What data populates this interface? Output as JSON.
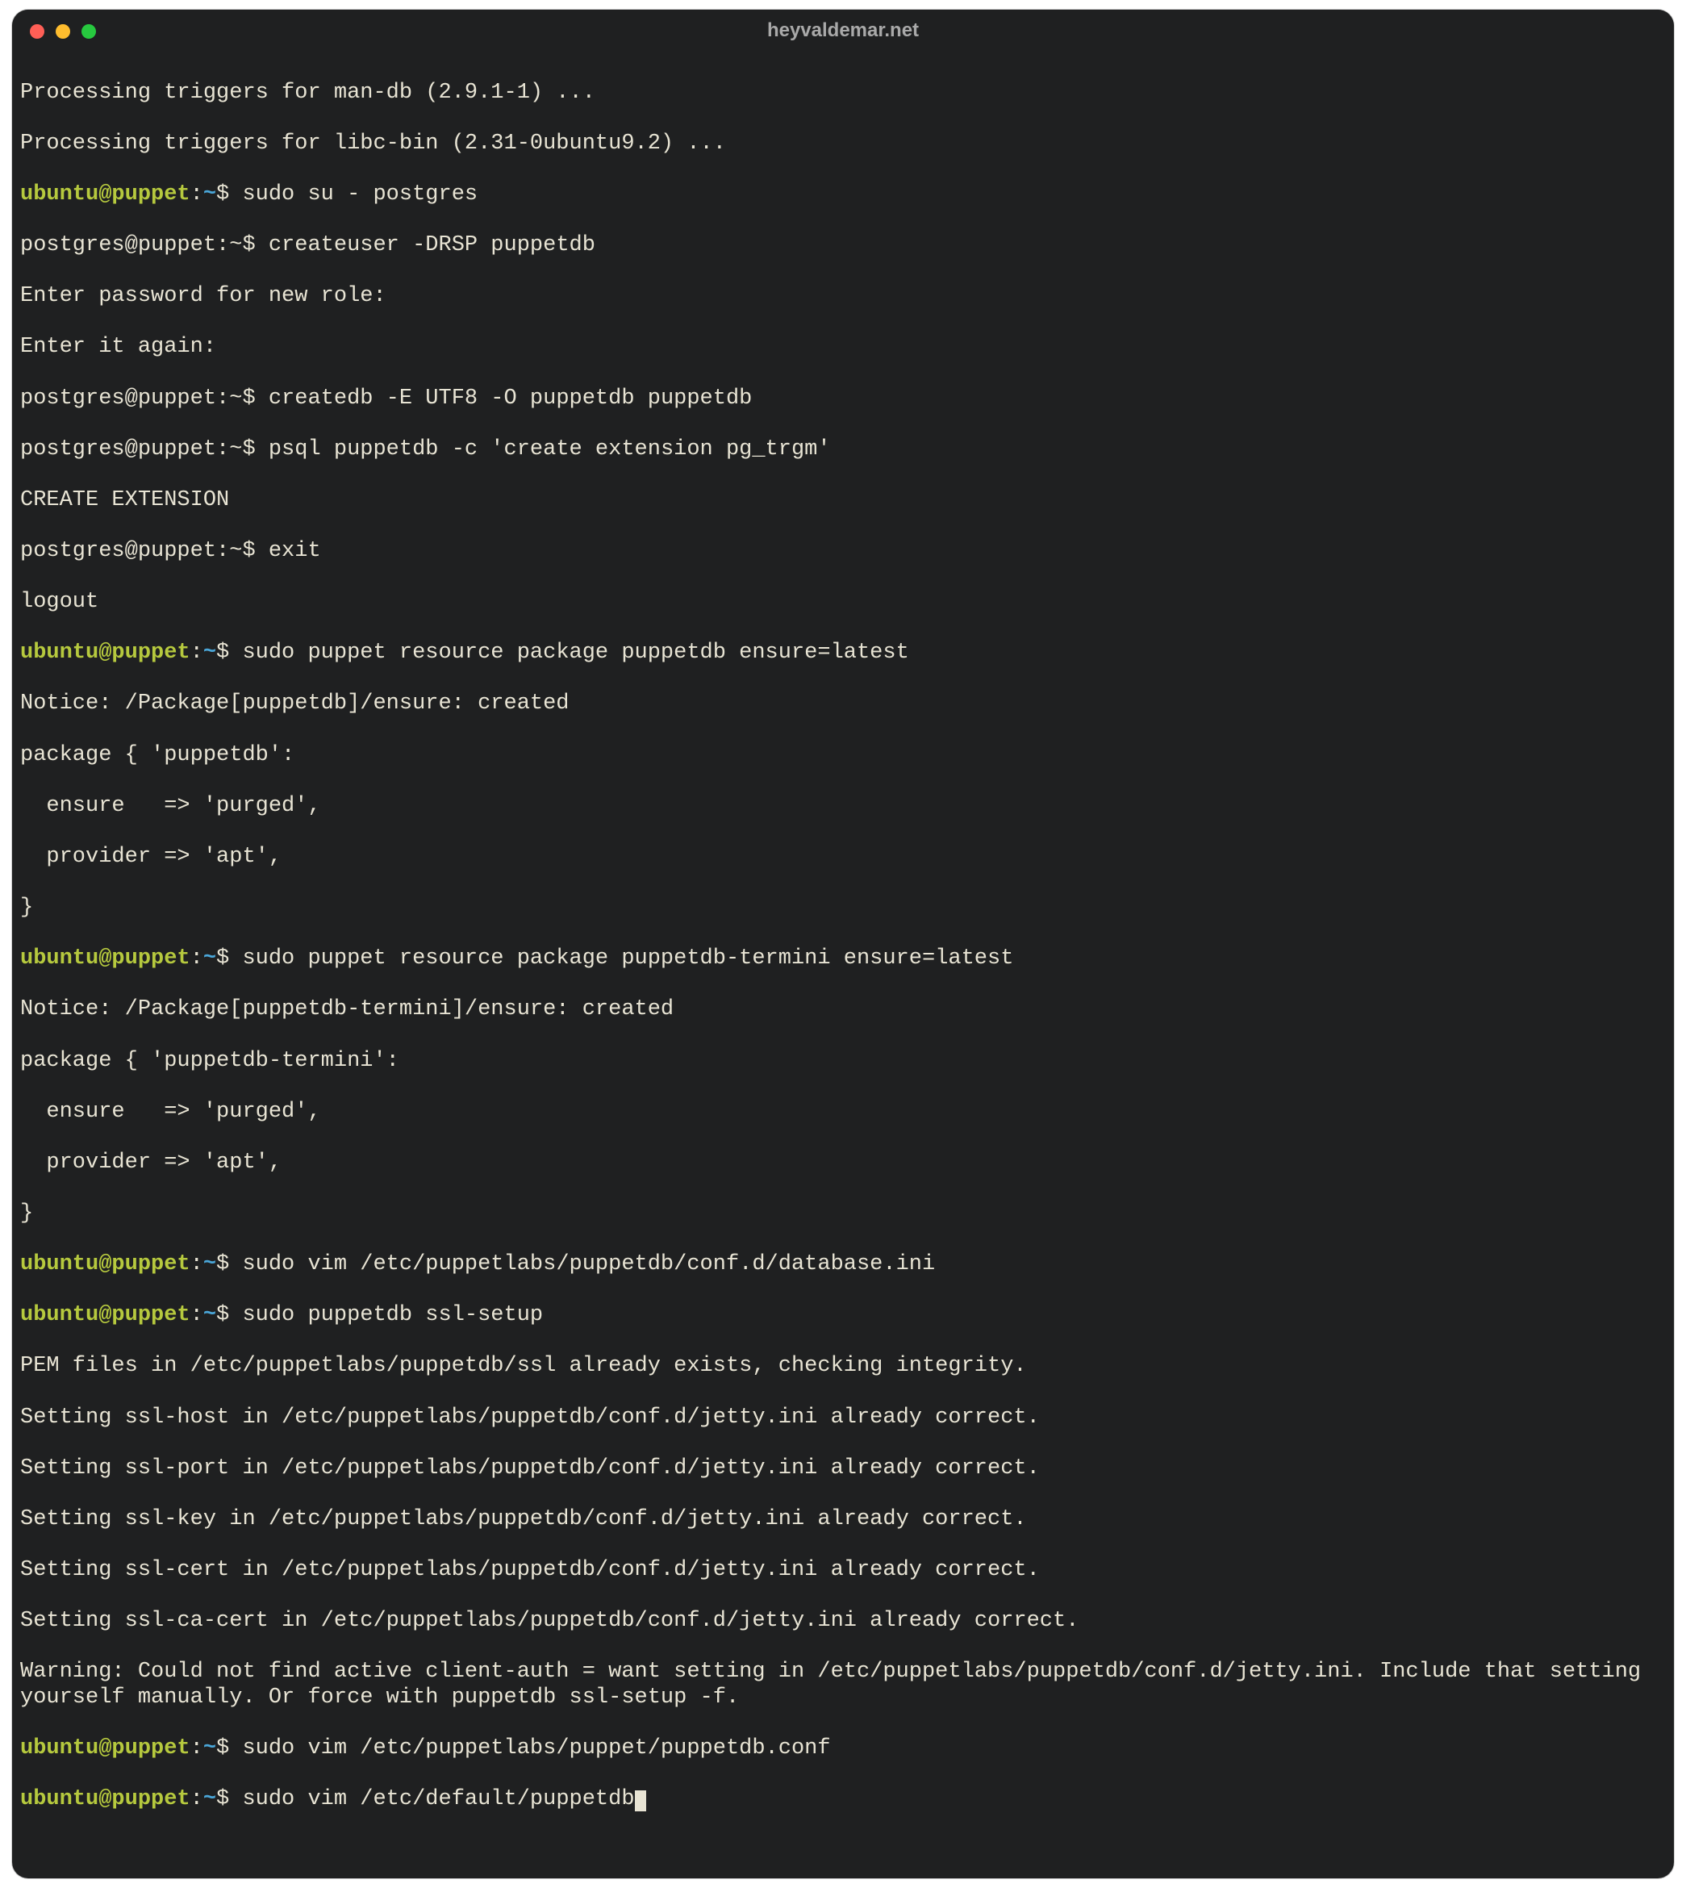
{
  "window": {
    "title": "heyvaldemar.net"
  },
  "colors": {
    "bg": "#1f2021",
    "fg": "#e8e4d4",
    "prompt_user": "#b6c93e",
    "prompt_path": "#4aa6d8",
    "red": "#ff5f56",
    "yellow": "#ffbd2e",
    "green": "#27c93f"
  },
  "prompt_ubuntu": {
    "user_host": "ubuntu@puppet",
    "sep": ":",
    "path": "~",
    "symbol": "$"
  },
  "prompt_postgres": {
    "prefix": "postgres@puppet:~$"
  },
  "lines": {
    "l0": "Processing triggers for man-db (2.9.1-1) ...",
    "l1": "Processing triggers for libc-bin (2.31-0ubuntu9.2) ...",
    "c2": " sudo su - postgres",
    "c3": " createuser -DRSP puppetdb",
    "l4": "Enter password for new role:",
    "l5": "Enter it again:",
    "c6": " createdb -E UTF8 -O puppetdb puppetdb",
    "c7": " psql puppetdb -c 'create extension pg_trgm'",
    "l8": "CREATE EXTENSION",
    "c9": " exit",
    "l10": "logout",
    "c11": " sudo puppet resource package puppetdb ensure=latest",
    "l12": "Notice: /Package[puppetdb]/ensure: created",
    "l13": "package { 'puppetdb':",
    "l14": "  ensure   => 'purged',",
    "l15": "  provider => 'apt',",
    "l16": "}",
    "c17": " sudo puppet resource package puppetdb-termini ensure=latest",
    "l18": "Notice: /Package[puppetdb-termini]/ensure: created",
    "l19": "package { 'puppetdb-termini':",
    "l20": "  ensure   => 'purged',",
    "l21": "  provider => 'apt',",
    "l22": "}",
    "c23": " sudo vim /etc/puppetlabs/puppetdb/conf.d/database.ini",
    "c24": " sudo puppetdb ssl-setup",
    "l25": "PEM files in /etc/puppetlabs/puppetdb/ssl already exists, checking integrity.",
    "l26": "Setting ssl-host in /etc/puppetlabs/puppetdb/conf.d/jetty.ini already correct.",
    "l27": "Setting ssl-port in /etc/puppetlabs/puppetdb/conf.d/jetty.ini already correct.",
    "l28": "Setting ssl-key in /etc/puppetlabs/puppetdb/conf.d/jetty.ini already correct.",
    "l29": "Setting ssl-cert in /etc/puppetlabs/puppetdb/conf.d/jetty.ini already correct.",
    "l30": "Setting ssl-ca-cert in /etc/puppetlabs/puppetdb/conf.d/jetty.ini already correct.",
    "l31": "Warning: Could not find active client-auth = want setting in /etc/puppetlabs/puppetdb/conf.d/jetty.ini. Include that setting yourself manually. Or force with puppetdb ssl-setup -f.",
    "c32": " sudo vim /etc/puppetlabs/puppet/puppetdb.conf",
    "c33": " sudo vim /etc/default/puppetdb"
  }
}
